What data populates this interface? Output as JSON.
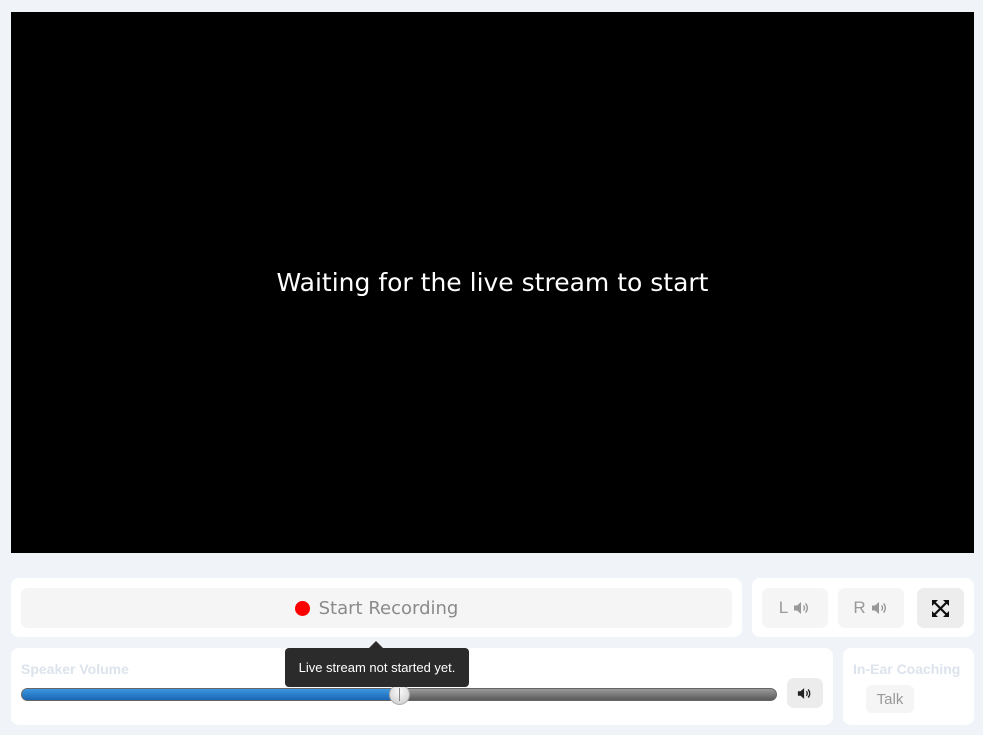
{
  "video": {
    "status_message": "Waiting for the live stream to start"
  },
  "recording": {
    "button_label": "Start Recording",
    "indicator_color": "#ff0000"
  },
  "channels": {
    "left_label": "L",
    "right_label": "R",
    "speaker_icon": "speaker-icon",
    "fullscreen_icon": "expand-arrows-icon"
  },
  "speaker_volume": {
    "label": "Speaker Volume",
    "level": 0.5,
    "fill_color": "#1a73c8",
    "mute_icon": "speaker-icon"
  },
  "coaching": {
    "label": "In-Ear Coaching",
    "talk_label": "Talk"
  },
  "tooltip": {
    "text": "Live stream not started yet."
  }
}
